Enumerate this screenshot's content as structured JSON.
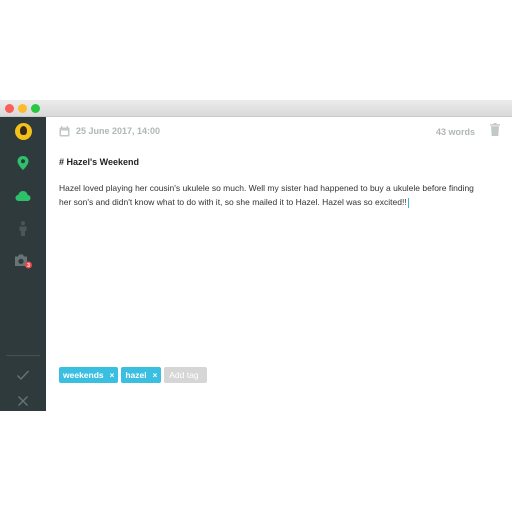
{
  "window": {
    "controls": [
      "close",
      "minimize",
      "zoom"
    ]
  },
  "sidebar": {
    "items": [
      {
        "icon": "avatar-icon"
      },
      {
        "icon": "location-pin-icon",
        "color": "#2fc16a"
      },
      {
        "icon": "cloud-icon",
        "color": "#2fc16a"
      },
      {
        "icon": "person-icon"
      },
      {
        "icon": "camera-icon",
        "badge": "3"
      }
    ],
    "actions": [
      {
        "icon": "check-icon"
      },
      {
        "icon": "close-icon"
      }
    ]
  },
  "entry": {
    "date": "25 June 2017, 14:00",
    "word_count": "43 words",
    "title": "# Hazel's Weekend",
    "body": "Hazel loved playing her cousin's ukulele so much. Well my sister had happened to buy a ukulele before finding her son's and didn't know what to do with it, so she mailed it to Hazel. Hazel was so excited!!"
  },
  "tags": {
    "items": [
      {
        "label": "weekends",
        "remove": "×"
      },
      {
        "label": "hazel",
        "remove": "×"
      }
    ],
    "add_placeholder": "Add tag"
  },
  "colors": {
    "sidebar_bg": "#2f3a3d",
    "accent": "#3bbfe0",
    "green": "#2fc16a",
    "badge": "#e84a4a"
  }
}
